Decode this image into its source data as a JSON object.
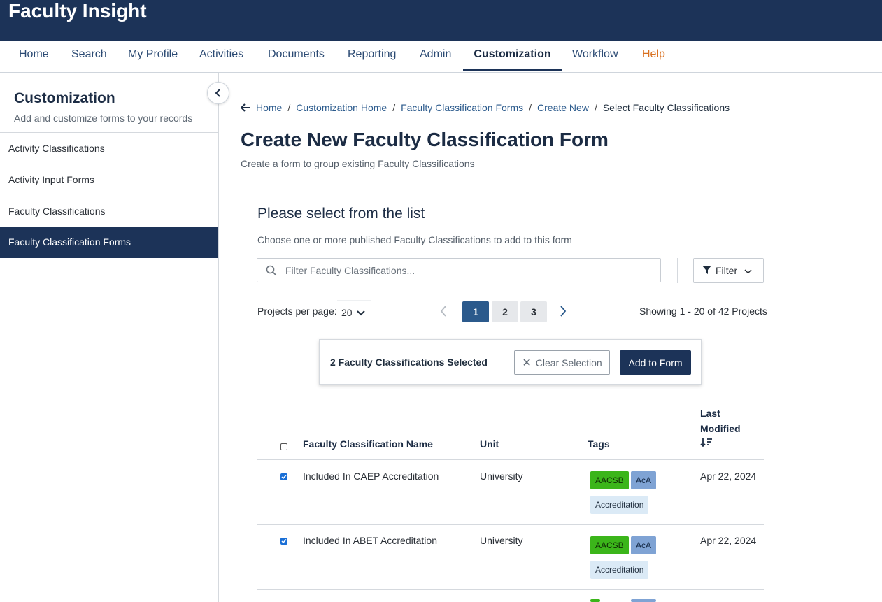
{
  "app": {
    "title": "Faculty Insight"
  },
  "nav": {
    "items": [
      {
        "label": "Home"
      },
      {
        "label": "Search"
      },
      {
        "label": "My Profile"
      },
      {
        "label": "Activities"
      },
      {
        "label": "Documents"
      },
      {
        "label": "Reporting"
      },
      {
        "label": "Admin"
      },
      {
        "label": "Customization",
        "active": true
      },
      {
        "label": "Workflow"
      },
      {
        "label": "Help"
      }
    ]
  },
  "sidebar": {
    "title": "Customization",
    "subtitle": "Add and customize forms to your records",
    "items": [
      {
        "label": "Activity Classifications"
      },
      {
        "label": "Activity Input Forms"
      },
      {
        "label": "Faculty Classifications"
      },
      {
        "label": "Faculty Classification Forms",
        "active": true
      }
    ]
  },
  "breadcrumb": {
    "items": [
      "Home",
      "Customization Home",
      "Faculty Classification Forms",
      "Create New"
    ],
    "current": "Select Faculty Classifications",
    "separator": "/"
  },
  "page": {
    "title": "Create New Faculty Classification Form",
    "subtitle": "Create a form to group existing Faculty Classifications"
  },
  "section": {
    "title": "Please select from the list",
    "subtitle": "Choose one or more published Faculty Classifications to add to this form"
  },
  "search": {
    "placeholder": "Filter Faculty Classifications...",
    "value": ""
  },
  "filter": {
    "label": "Filter"
  },
  "pagination": {
    "per_page_label": "Projects per page:",
    "per_page_value": "20",
    "pages": [
      "1",
      "2",
      "3"
    ],
    "current_page": "1",
    "showing": "Showing 1 - 20 of 42 Projects"
  },
  "selection": {
    "text": "2 Faculty Classifications Selected",
    "clear_label": "Clear Selection",
    "add_label": "Add to Form"
  },
  "table": {
    "headers": {
      "name": "Faculty Classification Name",
      "unit": "Unit",
      "tags": "Tags",
      "last_modified_1": "Last",
      "last_modified_2": "Modified"
    },
    "rows": [
      {
        "checked": true,
        "name": "Included In CAEP Accreditation",
        "unit": "University",
        "tags": [
          "AACSB",
          "AcA",
          "Accreditation"
        ],
        "modified": "Apr 22, 2024"
      },
      {
        "checked": true,
        "name": "Included In ABET Accreditation",
        "unit": "University",
        "tags": [
          "AACSB",
          "AcA",
          "Accreditation"
        ],
        "modified": "Apr 22, 2024"
      }
    ]
  },
  "colors": {
    "brand": "#1c3358",
    "link": "#2b5a8c",
    "help": "#d9701f",
    "tag_green": "#3bb51a",
    "tag_blue": "#7fa3d4",
    "tag_light": "#dbeaf6"
  }
}
